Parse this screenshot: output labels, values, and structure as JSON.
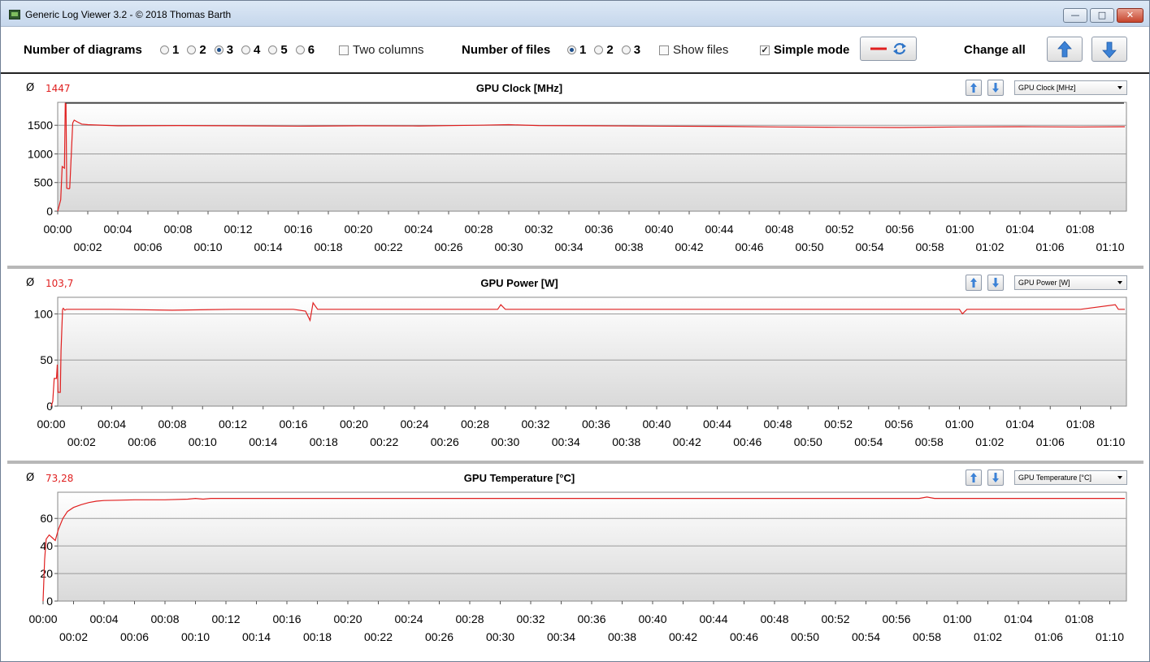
{
  "window": {
    "title": "Generic Log Viewer 3.2 - © 2018 Thomas Barth",
    "min_label": "—",
    "max_label": "□",
    "close_label": "✕"
  },
  "toolbar": {
    "diagrams_label": "Number of diagrams",
    "diagram_options": [
      "1",
      "2",
      "3",
      "4",
      "5",
      "6"
    ],
    "diagrams_selected": "3",
    "two_columns_label": "Two columns",
    "two_columns_checked": false,
    "files_label": "Number of files",
    "file_options": [
      "1",
      "2",
      "3"
    ],
    "files_selected": "1",
    "show_files_label": "Show files",
    "show_files_checked": false,
    "simple_mode_label": "Simple mode",
    "simple_mode_checked": true,
    "change_all_label": "Change all",
    "line_color": "#e02020",
    "refresh_icon": "refresh-icon",
    "up_icon": "arrow-up-icon",
    "down_icon": "arrow-down-icon",
    "arrow_color": "#3c82d6"
  },
  "diagrams": [
    {
      "avg_symbol": "Ø",
      "avg_value": "1447",
      "title": "GPU Clock [MHz]",
      "select_value": "GPU Clock [MHz]"
    },
    {
      "avg_symbol": "Ø",
      "avg_value": "103,7",
      "title": "GPU Power [W]",
      "select_value": "GPU Power [W]"
    },
    {
      "avg_symbol": "Ø",
      "avg_value": "73,28",
      "title": "GPU Temperature [°C]",
      "select_value": "GPU Temperature [°C]"
    }
  ],
  "chart_data": [
    {
      "type": "line",
      "title": "GPU Clock [MHz]",
      "ylim": [
        0,
        1900
      ],
      "yticks": [
        0,
        500,
        1000,
        1500
      ],
      "xlim_minutes": [
        0,
        71.3
      ],
      "x_tick_labels_top": [
        "00:00",
        "00:04",
        "00:08",
        "00:12",
        "00:16",
        "00:20",
        "00:24",
        "00:28",
        "00:32",
        "00:36",
        "00:40",
        "00:44",
        "00:48",
        "00:52",
        "00:56",
        "01:00",
        "01:04",
        "01:08"
      ],
      "x_tick_labels_bottom": [
        "00:02",
        "00:06",
        "00:10",
        "00:14",
        "00:18",
        "00:22",
        "00:26",
        "00:30",
        "00:34",
        "00:38",
        "00:42",
        "00:46",
        "00:50",
        "00:54",
        "00:58",
        "01:02",
        "01:06",
        "01:10"
      ],
      "max_line": 1885,
      "series": [
        {
          "color": "#e02020",
          "x": [
            0,
            0.2,
            0.3,
            0.45,
            0.5,
            0.55,
            0.6,
            0.75,
            0.8,
            1.0,
            1.1,
            1.3,
            1.6,
            2,
            4,
            8,
            12,
            16,
            20,
            24,
            28,
            30,
            32,
            36,
            40,
            44,
            48,
            52,
            56,
            60,
            64,
            68,
            71
          ],
          "y": [
            0,
            200,
            780,
            750,
            1880,
            1870,
            400,
            390,
            400,
            1540,
            1590,
            1560,
            1520,
            1510,
            1490,
            1495,
            1490,
            1485,
            1490,
            1488,
            1500,
            1510,
            1495,
            1490,
            1485,
            1480,
            1470,
            1465,
            1460,
            1470,
            1475,
            1470,
            1475
          ]
        }
      ]
    },
    {
      "type": "line",
      "title": "GPU Power [W]",
      "ylim": [
        0,
        118
      ],
      "yticks": [
        0,
        50,
        100
      ],
      "xlim_minutes": [
        0,
        71.3
      ],
      "x_tick_labels_top": [
        "00:00",
        "00:04",
        "00:08",
        "00:12",
        "00:16",
        "00:20",
        "00:24",
        "00:28",
        "00:32",
        "00:36",
        "00:40",
        "00:44",
        "00:48",
        "00:52",
        "00:56",
        "01:00",
        "01:04",
        "01:08"
      ],
      "x_tick_labels_bottom": [
        "00:02",
        "00:06",
        "00:10",
        "00:14",
        "00:18",
        "00:22",
        "00:26",
        "00:30",
        "00:34",
        "00:38",
        "00:42",
        "00:46",
        "00:50",
        "00:54",
        "00:58",
        "01:02",
        "01:06",
        "01:10"
      ],
      "series": [
        {
          "color": "#e02020",
          "x": [
            0,
            0.1,
            0.2,
            0.35,
            0.4,
            0.45,
            0.5,
            0.6,
            0.65,
            0.75,
            0.8,
            0.9,
            1.0,
            2,
            4,
            8,
            12,
            16,
            16.8,
            17.1,
            17.3,
            17.6,
            18,
            22,
            26,
            29.5,
            29.7,
            30,
            34,
            38,
            42,
            46,
            50,
            54,
            58,
            60,
            60.2,
            60.5,
            64,
            68,
            70.3,
            70.5,
            71
          ],
          "y": [
            0,
            5,
            30,
            30,
            45,
            15,
            15,
            15,
            60,
            105,
            106,
            104,
            105,
            105,
            105,
            104,
            105,
            105,
            103,
            93,
            112,
            105,
            105,
            105,
            105,
            105,
            110,
            105,
            105,
            105,
            105,
            105,
            105,
            105,
            105,
            105,
            100,
            105,
            105,
            105,
            110,
            105,
            105
          ]
        }
      ]
    },
    {
      "type": "line",
      "title": "GPU Temperature [°C]",
      "ylim": [
        0,
        79
      ],
      "yticks": [
        0,
        20,
        40,
        60
      ],
      "xlim_minutes": [
        0,
        71.3
      ],
      "x_tick_labels_top": [
        "00:00",
        "00:04",
        "00:08",
        "00:12",
        "00:16",
        "00:20",
        "00:24",
        "00:28",
        "00:32",
        "00:36",
        "00:40",
        "00:44",
        "00:48",
        "00:52",
        "00:56",
        "01:00",
        "01:04",
        "01:08"
      ],
      "x_tick_labels_bottom": [
        "00:02",
        "00:06",
        "00:10",
        "00:14",
        "00:18",
        "00:22",
        "00:26",
        "00:30",
        "00:34",
        "00:38",
        "00:42",
        "00:46",
        "00:50",
        "00:54",
        "00:58",
        "01:02",
        "01:06",
        "01:10"
      ],
      "series": [
        {
          "color": "#e02020",
          "x": [
            0,
            0.1,
            0.2,
            0.4,
            0.6,
            0.8,
            1.0,
            1.3,
            1.6,
            2.0,
            2.5,
            3.0,
            3.5,
            4.0,
            5,
            6,
            8,
            9.5,
            10,
            10.5,
            11,
            12,
            20,
            30,
            40,
            50,
            57.5,
            58,
            58.5,
            64,
            71
          ],
          "y": [
            0,
            30,
            45,
            48,
            46,
            44,
            52,
            60,
            65,
            68,
            70,
            71.5,
            72.5,
            73,
            73.2,
            73.5,
            73.5,
            74,
            74.5,
            74,
            74.5,
            74.5,
            74.5,
            74.5,
            74.5,
            74.5,
            74.5,
            75.5,
            74.5,
            74.5,
            74.5
          ]
        }
      ]
    }
  ]
}
